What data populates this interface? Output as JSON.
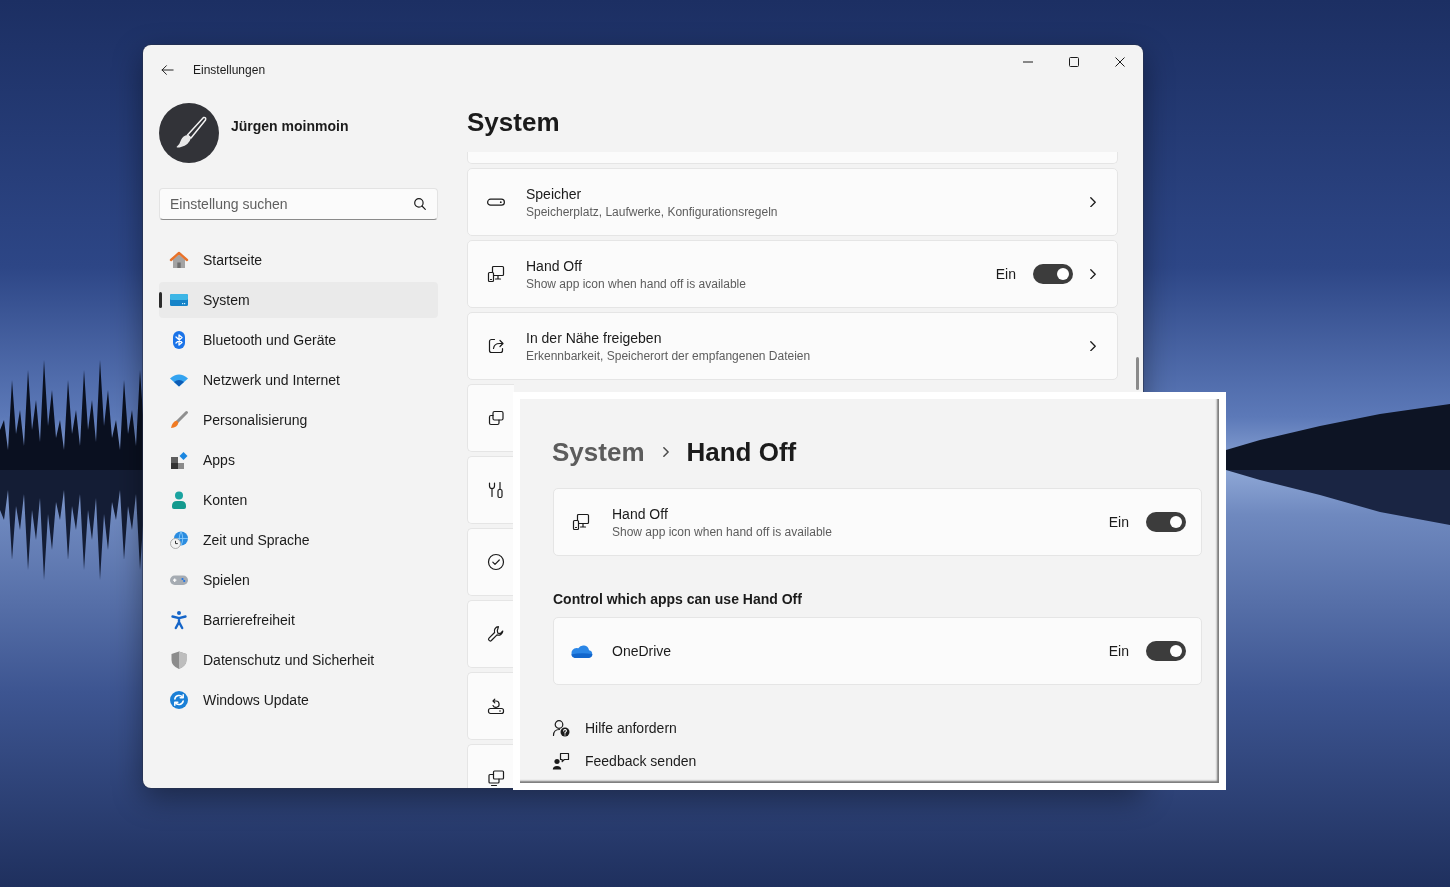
{
  "window": {
    "title": "Einstellungen"
  },
  "profile": {
    "name": "Jürgen moinmoin"
  },
  "search": {
    "placeholder": "Einstellung suchen"
  },
  "sidebar": {
    "items": [
      {
        "label": "Startseite",
        "selected": false
      },
      {
        "label": "System",
        "selected": true
      },
      {
        "label": "Bluetooth und Geräte",
        "selected": false
      },
      {
        "label": "Netzwerk und Internet",
        "selected": false
      },
      {
        "label": "Personalisierung",
        "selected": false
      },
      {
        "label": "Apps",
        "selected": false
      },
      {
        "label": "Konten",
        "selected": false
      },
      {
        "label": "Zeit und Sprache",
        "selected": false
      },
      {
        "label": "Spielen",
        "selected": false
      },
      {
        "label": "Barrierefreiheit",
        "selected": false
      },
      {
        "label": "Datenschutz und Sicherheit",
        "selected": false
      },
      {
        "label": "Windows Update",
        "selected": false
      }
    ]
  },
  "page": {
    "title": "System"
  },
  "cards": [
    {
      "kind": "link",
      "title": "Speicher",
      "subtitle": "Speicherplatz, Laufwerke, Konfigurationsregeln"
    },
    {
      "kind": "toggle_link",
      "title": "Hand Off",
      "subtitle": "Show app icon when hand off is available",
      "state_label": "Ein",
      "on": true
    },
    {
      "kind": "link",
      "title": "In der Nähe freigeben",
      "subtitle": "Erkennbarkeit, Speicherort der empfangenen Dateien"
    }
  ],
  "inset": {
    "breadcrumb": [
      "System",
      "Hand Off"
    ],
    "setting": {
      "title": "Hand Off",
      "subtitle": "Show app icon when hand off is available",
      "state_label": "Ein",
      "on": true
    },
    "section_title": "Control which apps can use Hand Off",
    "apps": [
      {
        "name": "OneDrive",
        "state_label": "Ein",
        "on": true
      }
    ],
    "links": [
      "Hilfe anfordern",
      "Feedback senden"
    ]
  }
}
